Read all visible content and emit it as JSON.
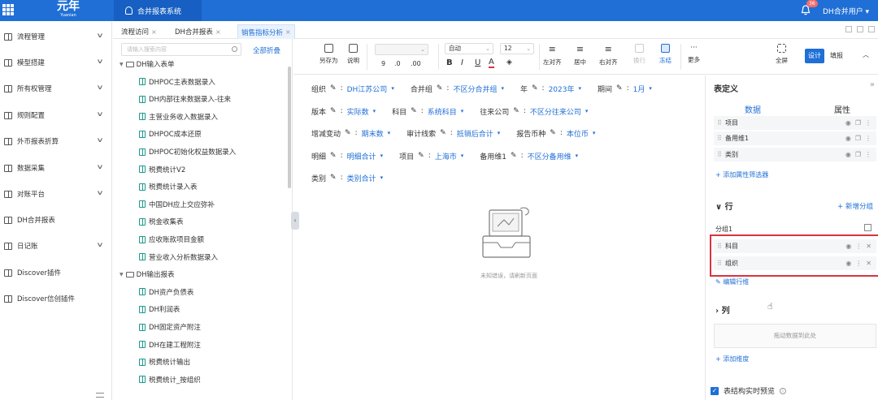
{
  "topbar": {
    "logo_cn": "元年",
    "logo_en": "Yuanian",
    "system_tab": "合并报表系统",
    "notification_count": "36",
    "user": "DH合并用户 ▾"
  },
  "sidebar": {
    "items": [
      {
        "label": "流程管理",
        "has_children": true
      },
      {
        "label": "模型搭建",
        "has_children": true
      },
      {
        "label": "所有权管理",
        "has_children": true
      },
      {
        "label": "规则配置",
        "has_children": true
      },
      {
        "label": "外币报表折算",
        "has_children": true
      },
      {
        "label": "数据采集",
        "has_children": true
      },
      {
        "label": "对账平台",
        "has_children": true
      },
      {
        "label": "DH合并报表",
        "has_children": false
      },
      {
        "label": "日记账",
        "has_children": true
      },
      {
        "label": "Discover插件",
        "has_children": false
      },
      {
        "label": "Discover信创插件",
        "has_children": false
      }
    ]
  },
  "tabs": [
    {
      "label": "流程访问",
      "active": false
    },
    {
      "label": "DH合并报表",
      "active": false
    },
    {
      "label": "销售指标分析",
      "active": true
    }
  ],
  "tree": {
    "search_placeholder": "请输入搜索内容",
    "collapse_all": "全部折叠",
    "folders": [
      {
        "label": "DH输入表单",
        "items": [
          "DHPOC主表数据录入",
          "DH内部往来数据录入-往来",
          "主营业务收入数据录入",
          "DHPOC成本还原",
          "DHPOC初始化权益数据录入",
          "税费统计V2",
          "税费统计录入表",
          "中国DH应上交应弥补",
          "税金收集表",
          "应收账款项目金额",
          "营业收入分析数据录入"
        ]
      },
      {
        "label": "DH输出报表",
        "items": [
          "DH资产负债表",
          "DH利润表",
          "DH固定资产附注",
          "DH在建工程附注",
          "税费统计输出",
          "税费统计_按组织"
        ]
      }
    ]
  },
  "toolbar": {
    "save_as": "另存为",
    "explain": "说明",
    "font_auto": "自动",
    "font_size": "12",
    "bold": "B",
    "italic": "I",
    "underline": "U",
    "font_color": "A",
    "align_left": "左对齐",
    "align_center": "居中",
    "align_right": "右对齐",
    "wrap": "换行",
    "freeze": "冻结",
    "more": "更多",
    "fullscreen": "全屏",
    "design": "设计",
    "fill": "填报",
    "thousands": "9",
    "decimal_up": ".0",
    "decimal_down": ".00"
  },
  "filters": [
    [
      {
        "label": "组织",
        "value": "DH江苏公司"
      },
      {
        "label": "合并组",
        "value": "不区分合并组"
      },
      {
        "label": "年",
        "value": "2023年"
      },
      {
        "label": "期间",
        "value": "1月"
      }
    ],
    [
      {
        "label": "版本",
        "value": "实际数"
      },
      {
        "label": "科目",
        "value": "系统科目"
      },
      {
        "label": "往来公司",
        "value": "不区分往来公司"
      }
    ],
    [
      {
        "label": "增减变动",
        "value": "期末数"
      },
      {
        "label": "审计线索",
        "value": "抵销后合计"
      },
      {
        "label": "报告币种",
        "value": "本位币"
      }
    ],
    [
      {
        "label": "明细",
        "value": "明细合计"
      },
      {
        "label": "项目",
        "value": "上海市"
      },
      {
        "label": "备用维1",
        "value": "不区分备用维"
      }
    ],
    [
      {
        "label": "类别",
        "value": "类别合计"
      }
    ]
  ],
  "empty_state": "未知错误，请刷新页面",
  "right_panel": {
    "title": "表定义",
    "tab_data": "数据",
    "tab_attr": "属性",
    "filter_fields": [
      "项目",
      "备用维1",
      "类别"
    ],
    "add_filter": "+ 添加属性筛选器",
    "row_section": "行",
    "add_group": "+ 新增分组",
    "group_name": "分组1",
    "row_fields": [
      "科目",
      "组织"
    ],
    "edit_rows": "编辑行维",
    "col_section": "列",
    "drop_hint": "拖动数据到此处",
    "add_dimension": "+ 添加维度",
    "preview_label": "表结构实时预览"
  },
  "colors": {
    "primary": "#1f6fd6",
    "highlight_border": "#d9333f"
  }
}
